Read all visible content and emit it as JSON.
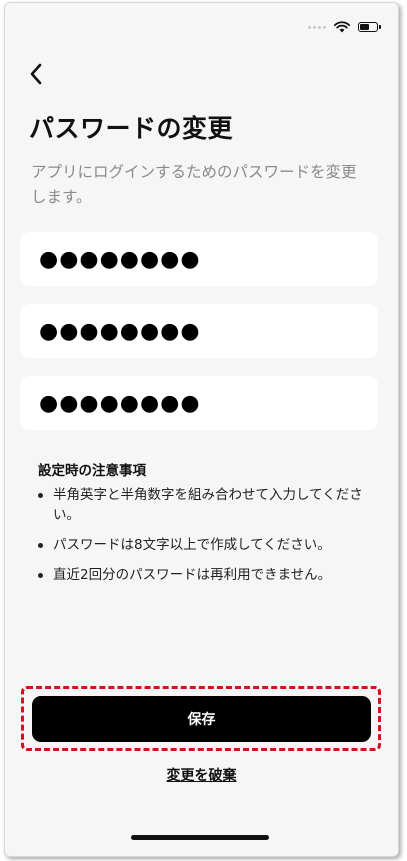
{
  "status_bar": {
    "wifi_icon": "wifi-icon",
    "battery_icon": "battery-icon"
  },
  "header": {
    "back_icon": "chevron-left-icon",
    "title": "パスワードの変更"
  },
  "description": "アプリにログインするためのパスワードを変更します。",
  "password_fields": [
    {
      "value": "●●●●●●●●"
    },
    {
      "value": "●●●●●●●●"
    },
    {
      "value": "●●●●●●●●"
    }
  ],
  "notes": {
    "title": "設定時の注意事項",
    "items": [
      "半角英字と半角数字を組み合わせて入力してください。",
      "パスワードは8文字以上で作成してください。",
      "直近2回分のパスワードは再利用できません。"
    ]
  },
  "actions": {
    "save_label": "保存",
    "discard_label": "変更を破棄"
  },
  "colors": {
    "accent": "#000000",
    "highlight": "#d0141e",
    "background": "#f6f6f6"
  }
}
